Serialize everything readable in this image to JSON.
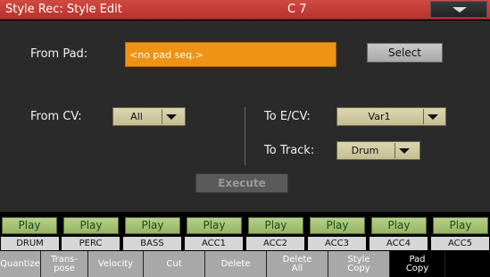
{
  "header": {
    "title": "Style Rec: Style Edit",
    "chord": "C 7",
    "menu_icon": "chevron-down-icon"
  },
  "from_pad": {
    "label": "From Pad:",
    "value": "<no pad seq.>",
    "select_label": "Select"
  },
  "from_cv": {
    "label": "From CV:",
    "value": "All"
  },
  "to_ecv": {
    "label": "To E/CV:",
    "value": "Var1"
  },
  "to_track": {
    "label": "To Track:",
    "value": "Drum"
  },
  "execute_label": "Execute",
  "tracks": [
    {
      "play": "Play",
      "name": "DRUM"
    },
    {
      "play": "Play",
      "name": "PERC"
    },
    {
      "play": "Play",
      "name": "BASS"
    },
    {
      "play": "Play",
      "name": "ACC1"
    },
    {
      "play": "Play",
      "name": "ACC2"
    },
    {
      "play": "Play",
      "name": "ACC3"
    },
    {
      "play": "Play",
      "name": "ACC4"
    },
    {
      "play": "Play",
      "name": "ACC5"
    }
  ],
  "tabs": [
    {
      "label": "Quantize"
    },
    {
      "label": "Trans-\npose"
    },
    {
      "label": "Velocity"
    },
    {
      "label": "Cut"
    },
    {
      "label": "Delete"
    },
    {
      "label": "Delete\nAll"
    },
    {
      "label": "Style\nCopy"
    },
    {
      "label": "Pad\nCopy",
      "active": true
    }
  ]
}
